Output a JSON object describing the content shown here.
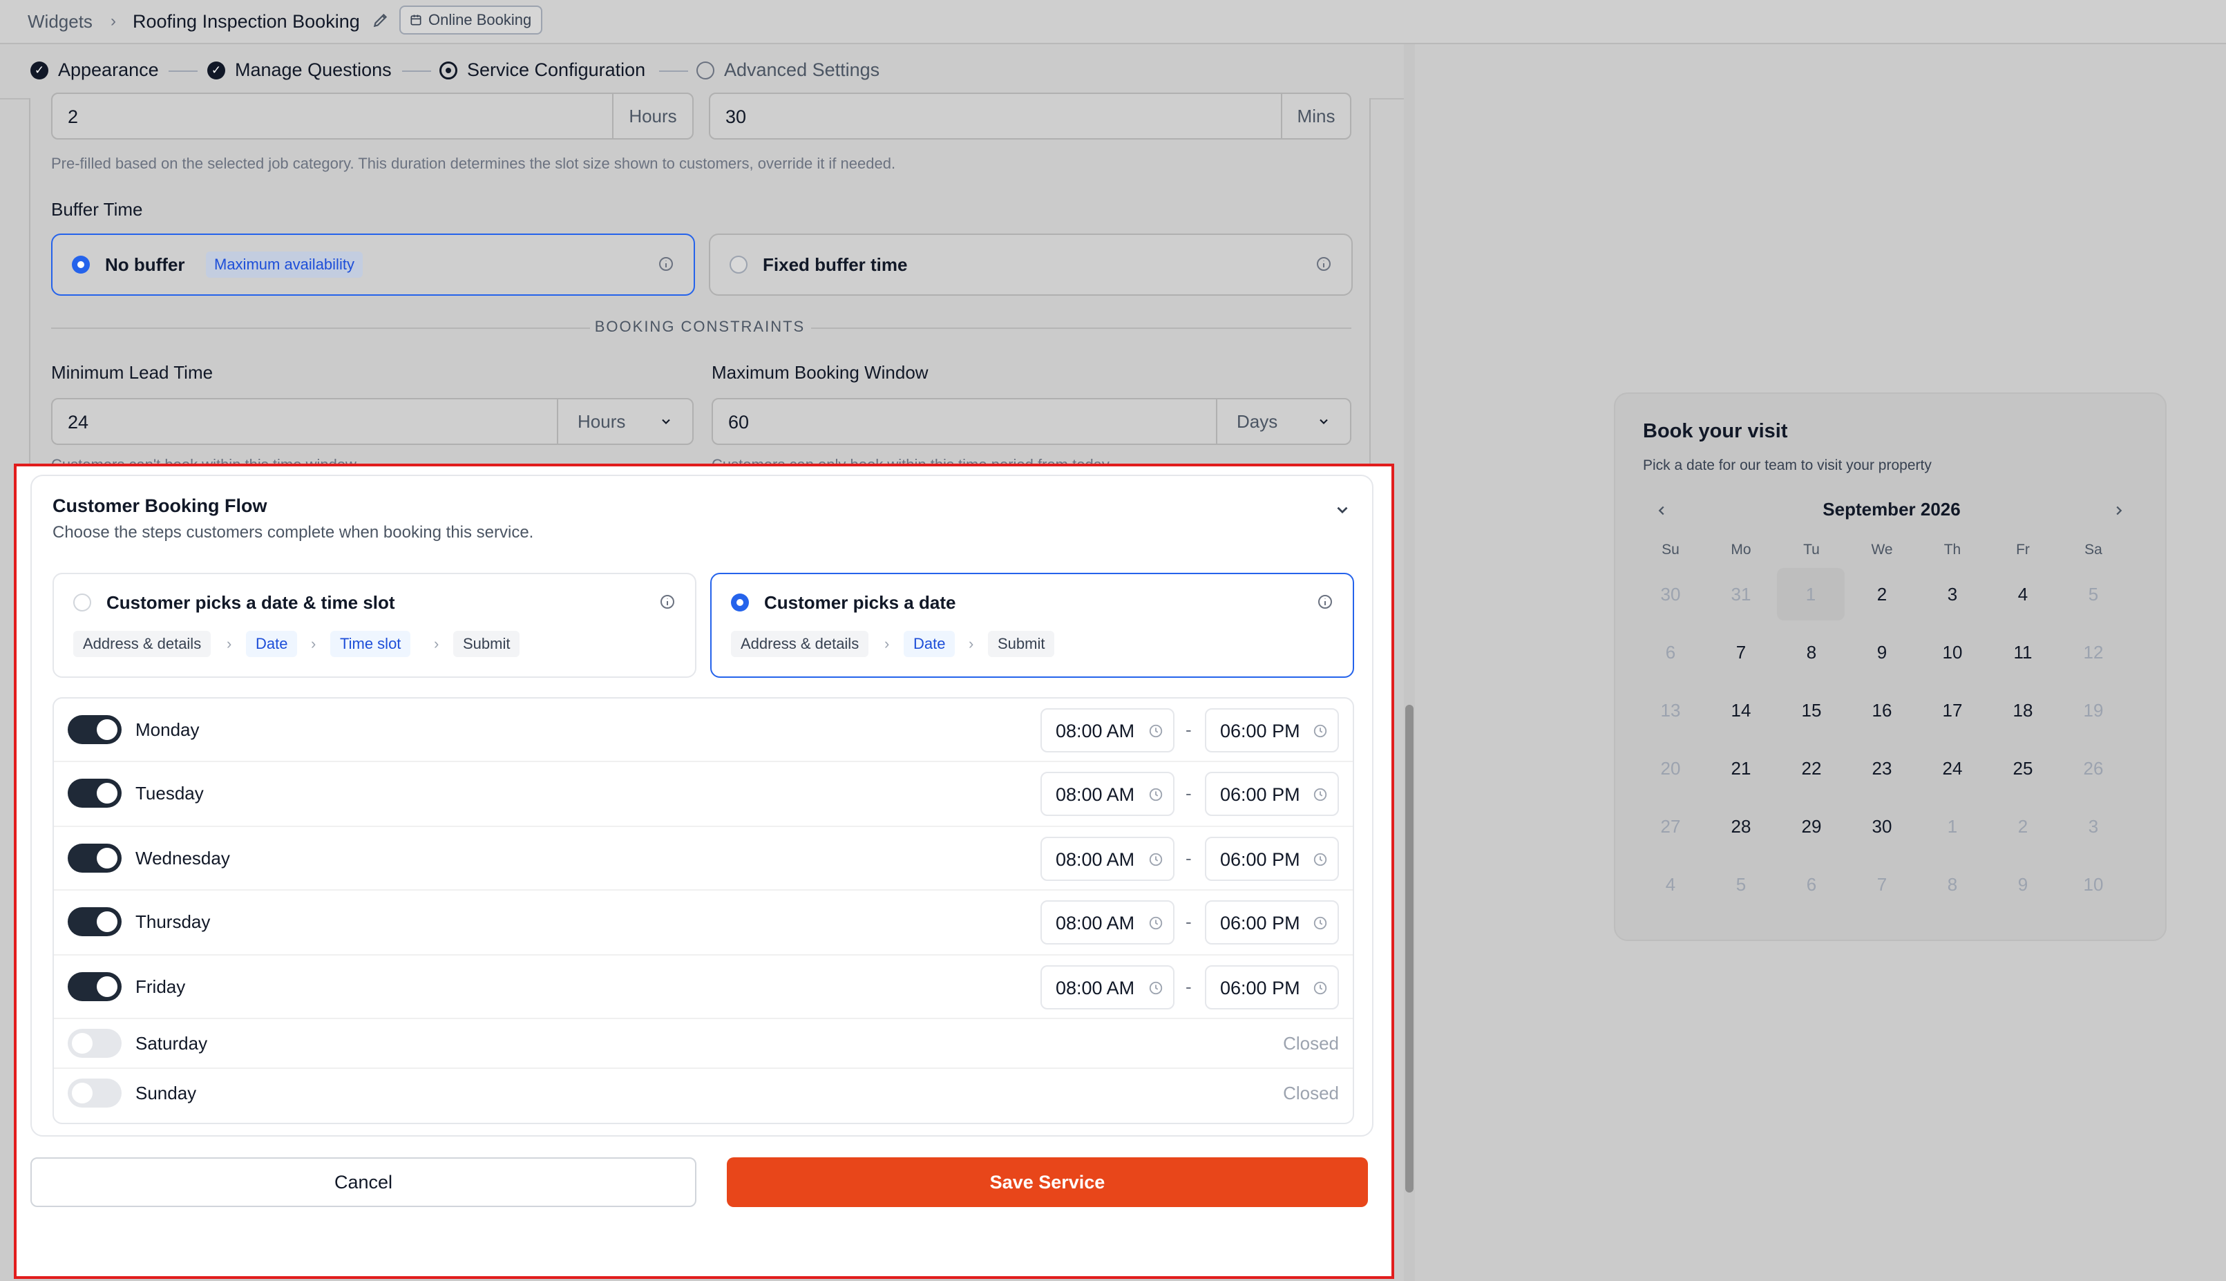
{
  "breadcrumb": {
    "root": "Widgets",
    "page": "Roofing Inspection Booking",
    "badge": "Online Booking"
  },
  "stepper": [
    {
      "label": "Appearance",
      "state": "done"
    },
    {
      "label": "Manage Questions",
      "state": "done"
    },
    {
      "label": "Service Configuration",
      "state": "current"
    },
    {
      "label": "Advanced Settings",
      "state": "todo"
    }
  ],
  "duration": {
    "hours_value": "2",
    "hours_unit": "Hours",
    "mins_value": "30",
    "mins_unit": "Mins",
    "help": "Pre-filled based on the selected job category. This duration determines the slot size shown to customers, override it if needed."
  },
  "buffer": {
    "label": "Buffer Time",
    "options": [
      {
        "label": "No buffer",
        "tag": "Maximum availability",
        "selected": true
      },
      {
        "label": "Fixed buffer time",
        "selected": false
      }
    ]
  },
  "constraints": {
    "heading": "BOOKING CONSTRAINTS",
    "min_lead": {
      "label": "Minimum Lead Time",
      "value": "24",
      "unit": "Hours",
      "help": "Customers can't book within this time window."
    },
    "max_window": {
      "label": "Maximum Booking Window",
      "value": "60",
      "unit": "Days",
      "help": "Customers can only book within this time period from today."
    }
  },
  "flow": {
    "title": "Customer Booking Flow",
    "description": "Choose the steps customers complete when booking this service.",
    "modes": [
      {
        "label": "Customer picks a date & time slot",
        "selected": false,
        "steps": [
          "Address & details",
          "Date",
          "Time slot",
          "Submit"
        ]
      },
      {
        "label": "Customer picks a date",
        "selected": true,
        "steps": [
          "Address & details",
          "Date",
          "Submit"
        ]
      }
    ],
    "separator": "-",
    "days": [
      {
        "name": "Monday",
        "enabled": true,
        "start": "08:00 AM",
        "end": "06:00 PM"
      },
      {
        "name": "Tuesday",
        "enabled": true,
        "start": "08:00 AM",
        "end": "06:00 PM"
      },
      {
        "name": "Wednesday",
        "enabled": true,
        "start": "08:00 AM",
        "end": "06:00 PM"
      },
      {
        "name": "Thursday",
        "enabled": true,
        "start": "08:00 AM",
        "end": "06:00 PM"
      },
      {
        "name": "Friday",
        "enabled": true,
        "start": "08:00 AM",
        "end": "06:00 PM"
      },
      {
        "name": "Saturday",
        "enabled": false,
        "status": "Closed"
      },
      {
        "name": "Sunday",
        "enabled": false,
        "status": "Closed"
      }
    ]
  },
  "actions": {
    "cancel": "Cancel",
    "save": "Save Service"
  },
  "preview": {
    "title": "Book your visit",
    "subtitle": "Pick a date for our team to visit your property",
    "month": "September 2026",
    "weekdays": [
      "Su",
      "Mo",
      "Tu",
      "We",
      "Th",
      "Fr",
      "Sa"
    ],
    "weeks": [
      [
        "30",
        "31",
        "1",
        "2",
        "3",
        "4",
        "5"
      ],
      [
        "6",
        "7",
        "8",
        "9",
        "10",
        "11",
        "12"
      ],
      [
        "13",
        "14",
        "15",
        "16",
        "17",
        "18",
        "19"
      ],
      [
        "20",
        "21",
        "22",
        "23",
        "24",
        "25",
        "26"
      ],
      [
        "27",
        "28",
        "29",
        "30",
        "1",
        "2",
        "3"
      ],
      [
        "4",
        "5",
        "6",
        "7",
        "8",
        "9",
        "10"
      ]
    ],
    "day_states": [
      [
        "out",
        "out",
        "past",
        "in",
        "in",
        "in",
        "out"
      ],
      [
        "out",
        "in",
        "in",
        "in",
        "in",
        "in",
        "out"
      ],
      [
        "out",
        "in",
        "in",
        "in",
        "in",
        "in",
        "out"
      ],
      [
        "out",
        "in",
        "in",
        "in",
        "in",
        "in",
        "out"
      ],
      [
        "out",
        "in",
        "in",
        "in",
        "out",
        "out",
        "out"
      ],
      [
        "out",
        "out",
        "out",
        "out",
        "out",
        "out",
        "out"
      ]
    ]
  },
  "colors": {
    "accent": "#2563eb",
    "save": "#e8461a",
    "highlight": "#e11d1d",
    "toggle_on": "#1f2937"
  }
}
